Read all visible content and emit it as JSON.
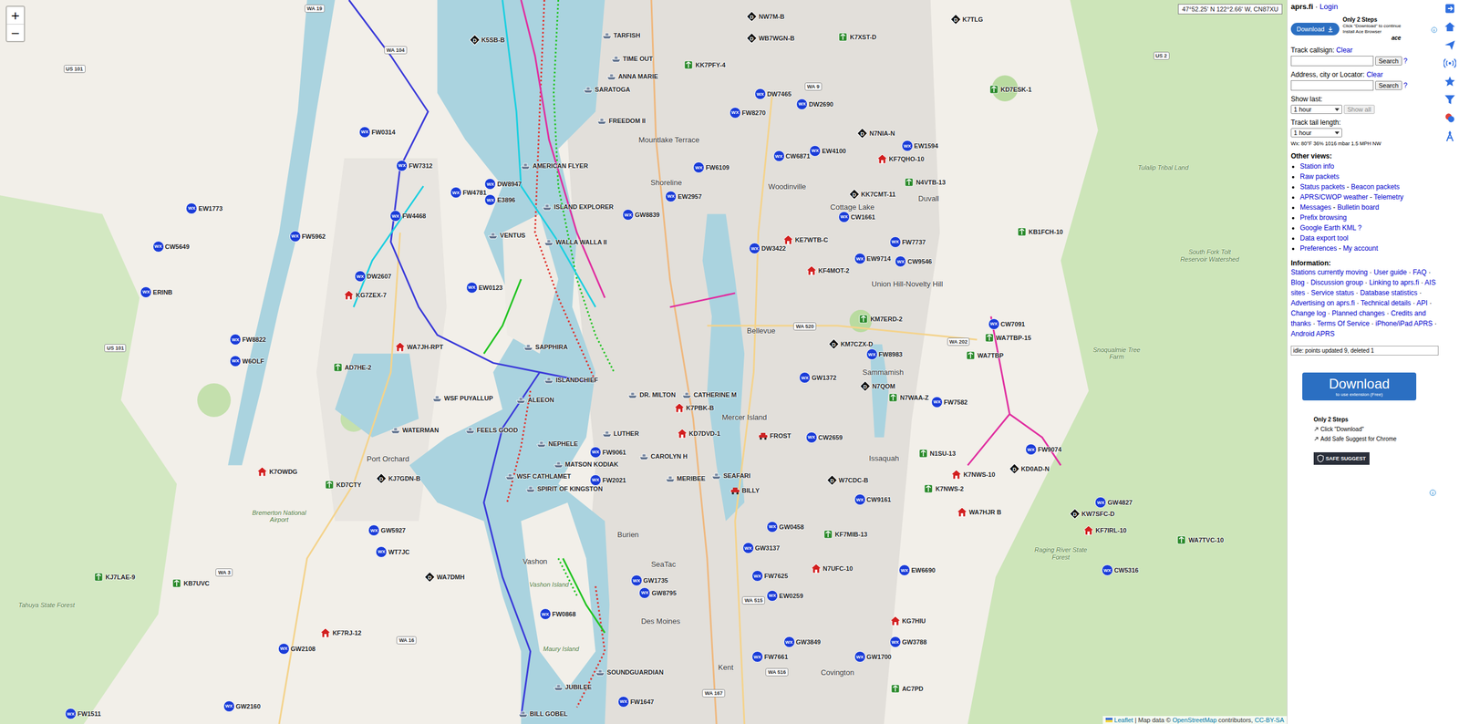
{
  "map": {
    "coords": "47°52.25' N 122°2.66' W, CN87XU",
    "zoom_in": "+",
    "zoom_out": "−",
    "symbols": {
      "wx": "WX",
      "digi": "D"
    },
    "attribution": {
      "leaflet": "Leaflet",
      "sep": " | Map data © ",
      "osm": "OpenStreetMap",
      "mid": " contributors, ",
      "license": "CC-BY-SA"
    },
    "tracks": [
      {
        "color": "#3b3bd9",
        "dashed": false
      },
      {
        "color": "#3b3bd9",
        "dashed": false
      },
      {
        "color": "#23c423",
        "dashed": true
      },
      {
        "color": "#e0302a",
        "dashed": true
      },
      {
        "color": "#1ccfe0",
        "dashed": false
      },
      {
        "color": "#e02fa0",
        "dashed": false
      },
      {
        "color": "#e0302a",
        "dashed": true
      },
      {
        "color": "#23c423",
        "dashed": false
      },
      {
        "color": "#e02fa0",
        "dashed": false
      }
    ],
    "places": [
      {
        "name": "Bellevue",
        "kind": "city"
      },
      {
        "name": "Kent",
        "kind": "city"
      },
      {
        "name": "Burien",
        "kind": "city"
      },
      {
        "name": "SeaTac",
        "kind": "city"
      },
      {
        "name": "Des Moines",
        "kind": "city"
      },
      {
        "name": "Vashon",
        "kind": "city"
      },
      {
        "name": "Vashon Island",
        "kind": "area"
      },
      {
        "name": "Maury Island",
        "kind": "area"
      },
      {
        "name": "Port Orchard",
        "kind": "city"
      },
      {
        "name": "Issaquah",
        "kind": "city"
      },
      {
        "name": "Sammamish",
        "kind": "city"
      },
      {
        "name": "Duvall",
        "kind": "city"
      },
      {
        "name": "Cottage Lake",
        "kind": "city"
      },
      {
        "name": "Woodinville",
        "kind": "city"
      },
      {
        "name": "Shoreline",
        "kind": "city"
      },
      {
        "name": "Mountlake Terrace",
        "kind": "city"
      },
      {
        "name": "Covington",
        "kind": "city"
      },
      {
        "name": "Snoqualmie Tree Farm",
        "kind": "area"
      },
      {
        "name": "Tulalip Tribal Land",
        "kind": "area"
      },
      {
        "name": "South Fork Tolt Reservoir Watershed",
        "kind": "area"
      },
      {
        "name": "Union Hill-Novelty Hill",
        "kind": "city"
      },
      {
        "name": "Bremerton National Airport",
        "kind": "area"
      },
      {
        "name": "Tahuya State Forest",
        "kind": "area"
      },
      {
        "name": "Raging River State Forest",
        "kind": "area"
      },
      {
        "name": "Mercer Island",
        "kind": "city"
      }
    ],
    "shields": [
      "US 101",
      "US 101",
      "WA 3",
      "WA 16",
      "WA 104",
      "WA 19",
      "WA 9",
      "WA 202",
      "WA 520",
      "WA 167",
      "WA 516",
      "WA 515",
      "US 2"
    ],
    "stations": [
      {
        "name": "EW1773",
        "kind": "wx"
      },
      {
        "name": "CW5649",
        "kind": "wx"
      },
      {
        "name": "ERINB",
        "kind": "wx"
      },
      {
        "name": "FW8822",
        "kind": "wx"
      },
      {
        "name": "W6OLF",
        "kind": "wx"
      },
      {
        "name": "FW0314",
        "kind": "wx"
      },
      {
        "name": "FW7312",
        "kind": "wx"
      },
      {
        "name": "FW4781",
        "kind": "wx"
      },
      {
        "name": "FW4468",
        "kind": "wx"
      },
      {
        "name": "FW5962",
        "kind": "wx"
      },
      {
        "name": "DW2607",
        "kind": "wx"
      },
      {
        "name": "DW8947",
        "kind": "wx"
      },
      {
        "name": "E3896",
        "kind": "wx"
      },
      {
        "name": "EW0123",
        "kind": "wx"
      },
      {
        "name": "EW4100",
        "kind": "wx"
      },
      {
        "name": "DW2690",
        "kind": "wx"
      },
      {
        "name": "DW7465",
        "kind": "wx"
      },
      {
        "name": "FW8270",
        "kind": "wx"
      },
      {
        "name": "CW6871",
        "kind": "wx"
      },
      {
        "name": "DW3422",
        "kind": "wx"
      },
      {
        "name": "CW1661",
        "kind": "wx"
      },
      {
        "name": "EW9714",
        "kind": "wx"
      },
      {
        "name": "CW9546",
        "kind": "wx"
      },
      {
        "name": "FW7737",
        "kind": "wx"
      },
      {
        "name": "FW7582",
        "kind": "wx"
      },
      {
        "name": "GW1372",
        "kind": "wx"
      },
      {
        "name": "CW2659",
        "kind": "wx"
      },
      {
        "name": "CW9161",
        "kind": "wx"
      },
      {
        "name": "GW0458",
        "kind": "wx"
      },
      {
        "name": "GW3137",
        "kind": "wx"
      },
      {
        "name": "FW7625",
        "kind": "wx"
      },
      {
        "name": "EW0259",
        "kind": "wx"
      },
      {
        "name": "GW3849",
        "kind": "wx"
      },
      {
        "name": "FW7661",
        "kind": "wx"
      },
      {
        "name": "GW1700",
        "kind": "wx"
      },
      {
        "name": "GW3788",
        "kind": "wx"
      },
      {
        "name": "EW6690",
        "kind": "wx"
      },
      {
        "name": "CW5316",
        "kind": "wx"
      },
      {
        "name": "GW4827",
        "kind": "wx"
      },
      {
        "name": "FW9074",
        "kind": "wx"
      },
      {
        "name": "FW0868",
        "kind": "wx"
      },
      {
        "name": "GW2108",
        "kind": "wx"
      },
      {
        "name": "GW2160",
        "kind": "wx"
      },
      {
        "name": "FW1511",
        "kind": "wx"
      },
      {
        "name": "FW1647",
        "kind": "wx"
      },
      {
        "name": "GW1735",
        "kind": "wx"
      },
      {
        "name": "GW8795",
        "kind": "wx"
      },
      {
        "name": "FW2021",
        "kind": "wx"
      },
      {
        "name": "FW9061",
        "kind": "wx"
      },
      {
        "name": "GW5927",
        "kind": "wx"
      },
      {
        "name": "WT7JC",
        "kind": "wx"
      },
      {
        "name": "FW8983",
        "kind": "wx"
      },
      {
        "name": "GW8839",
        "kind": "wx"
      },
      {
        "name": "EW2957",
        "kind": "wx"
      },
      {
        "name": "FW6109",
        "kind": "wx"
      },
      {
        "name": "EW1594",
        "kind": "wx"
      },
      {
        "name": "CW7091",
        "kind": "wx"
      },
      {
        "name": "K5SB-B",
        "kind": "digi"
      },
      {
        "name": "NW7M-B",
        "kind": "digi"
      },
      {
        "name": "WB7WGN-B",
        "kind": "digi"
      },
      {
        "name": "K7TLG",
        "kind": "digi"
      },
      {
        "name": "K7XST-D",
        "kind": "node"
      },
      {
        "name": "KD7ESK-1",
        "kind": "node"
      },
      {
        "name": "N7NIA-N",
        "kind": "digi"
      },
      {
        "name": "KF7QHO-10",
        "kind": "home"
      },
      {
        "name": "N4VTB-13",
        "kind": "node"
      },
      {
        "name": "KK7CMT-11",
        "kind": "digi"
      },
      {
        "name": "KE7WTB-C",
        "kind": "home"
      },
      {
        "name": "KF4MOT-2",
        "kind": "home"
      },
      {
        "name": "KM7ERD-2",
        "kind": "node"
      },
      {
        "name": "KM7CZX-D",
        "kind": "digi"
      },
      {
        "name": "N7QOM",
        "kind": "digi"
      },
      {
        "name": "N7WAA-Z",
        "kind": "node"
      },
      {
        "name": "W7CDC-B",
        "kind": "digi"
      },
      {
        "name": "N1SU-13",
        "kind": "node"
      },
      {
        "name": "K7NWS-10",
        "kind": "home"
      },
      {
        "name": "K7NWS-2",
        "kind": "node"
      },
      {
        "name": "WA7HJR B",
        "kind": "home"
      },
      {
        "name": "KD0AD-N",
        "kind": "digi"
      },
      {
        "name": "KW7SFC-D",
        "kind": "digi"
      },
      {
        "name": "KF7IRL-10",
        "kind": "home"
      },
      {
        "name": "WA7TVC-10",
        "kind": "node"
      },
      {
        "name": "KF7MIB-13",
        "kind": "node"
      },
      {
        "name": "N7UFC-10",
        "kind": "home"
      },
      {
        "name": "KG7HIU",
        "kind": "home"
      },
      {
        "name": "AC7PD",
        "kind": "node"
      },
      {
        "name": "KD7CTY",
        "kind": "node"
      },
      {
        "name": "KJ7GDN-B",
        "kind": "digi"
      },
      {
        "name": "K7OWDG",
        "kind": "home"
      },
      {
        "name": "KJ7LAE-9",
        "kind": "node"
      },
      {
        "name": "KB7UVC",
        "kind": "node"
      },
      {
        "name": "KF7RJ-12",
        "kind": "home"
      },
      {
        "name": "WA7DMH",
        "kind": "digi"
      },
      {
        "name": "AD7HE-2",
        "kind": "node"
      },
      {
        "name": "KG7ZEX-7",
        "kind": "home"
      },
      {
        "name": "KK7PFY-4",
        "kind": "node"
      },
      {
        "name": "KB1FCH-10",
        "kind": "node"
      },
      {
        "name": "WA7TBP-15",
        "kind": "node"
      },
      {
        "name": "WA7TBP",
        "kind": "node"
      },
      {
        "name": "K7PBK-B",
        "kind": "home"
      },
      {
        "name": "KD7DVD-1",
        "kind": "home"
      },
      {
        "name": "WA7JH-RPT",
        "kind": "home"
      },
      {
        "name": "TARFISH",
        "kind": "ship"
      },
      {
        "name": "TIME OUT",
        "kind": "ship"
      },
      {
        "name": "ANNA MARIE",
        "kind": "ship"
      },
      {
        "name": "SARATOGA",
        "kind": "ship"
      },
      {
        "name": "FREEDOM II",
        "kind": "ship"
      },
      {
        "name": "AMERICAN FLYER",
        "kind": "ship"
      },
      {
        "name": "ISLAND EXPLORER",
        "kind": "ship"
      },
      {
        "name": "WALLA WALLA II",
        "kind": "ship"
      },
      {
        "name": "VENTUS",
        "kind": "ship"
      },
      {
        "name": "SAPPHIRA",
        "kind": "ship"
      },
      {
        "name": "WSF PUYALLUP",
        "kind": "ship"
      },
      {
        "name": "ALEEON",
        "kind": "ship"
      },
      {
        "name": "ISLANDCHIEF",
        "kind": "ship"
      },
      {
        "name": "NEPHELE",
        "kind": "ship"
      },
      {
        "name": "MATSON KODIAK",
        "kind": "ship"
      },
      {
        "name": "WSF CATHLAMET",
        "kind": "ship"
      },
      {
        "name": "SPIRIT OF KINGSTON",
        "kind": "ship"
      },
      {
        "name": "FEELS GOOD",
        "kind": "ship"
      },
      {
        "name": "WATERMAN",
        "kind": "ship"
      },
      {
        "name": "LUTHER",
        "kind": "ship"
      },
      {
        "name": "CAROLYN H",
        "kind": "ship"
      },
      {
        "name": "MERIBEE",
        "kind": "ship"
      },
      {
        "name": "SEAFARI",
        "kind": "ship"
      },
      {
        "name": "DR. MILTON",
        "kind": "ship"
      },
      {
        "name": "CATHERINE M",
        "kind": "ship"
      },
      {
        "name": "FROST",
        "kind": "car"
      },
      {
        "name": "BILLY",
        "kind": "car"
      },
      {
        "name": "SOUNDGUARDIAN",
        "kind": "ship"
      },
      {
        "name": "JUBILEE",
        "kind": "ship"
      },
      {
        "name": "BILL GOBEL",
        "kind": "ship"
      }
    ]
  },
  "sidebar": {
    "header": {
      "site": "aprs.fi",
      "sep": " · ",
      "login": "Login"
    },
    "ad_small": {
      "button": "Download",
      "title": "Only 2 Steps",
      "steps": [
        "Click \"Download\" to continue",
        "Install Ace Browser"
      ],
      "brand": "ace"
    },
    "track": {
      "label": "Track callsign:",
      "clear": "Clear",
      "value": "",
      "search": "Search",
      "help": "?"
    },
    "address": {
      "label": "Address, city or Locator:",
      "clear": "Clear",
      "value": "",
      "search": "Search",
      "help": "?"
    },
    "show_last": {
      "label": "Show last:",
      "value": "1 hour",
      "show_all": "Show all",
      "show_all_disabled": true
    },
    "tail": {
      "label": "Track tail length:",
      "value": "1 hour"
    },
    "wx": "Wx: 80°F 36% 1016 mbar 1.5 MPH NW",
    "other_views": {
      "title": "Other views:",
      "sep": " - ",
      "lines": [
        [
          "Station info"
        ],
        [
          "Raw packets"
        ],
        [
          "Status packets",
          "Beacon packets"
        ],
        [
          "APRS/CWOP weather",
          "Telemetry"
        ],
        [
          "Messages",
          "Bulletin board"
        ],
        [
          "Prefix browsing"
        ],
        [
          "Google Earth KML ?"
        ],
        [
          "Data export tool"
        ],
        [
          "Preferences",
          "My account"
        ]
      ]
    },
    "information": {
      "title": "Information:",
      "sep": " · ",
      "links": [
        "Stations currently moving",
        "User guide",
        "FAQ",
        "Blog",
        "Discussion group",
        "Linking to aprs.fi",
        "AIS sites",
        "Service status",
        "Database statistics",
        "Advertising on aprs.fi",
        "Technical details",
        "API",
        "Change log",
        "Planned changes",
        "Credits and thanks",
        "Terms Of Service",
        "iPhone/iPad APRS",
        "Android APRS"
      ]
    },
    "status": "idle: points updated 9, deleted 1",
    "ad_large": {
      "button": "Download",
      "sub": "to use extension (Free)",
      "title": "Only 2 Steps",
      "steps": [
        "Click \"Download\"",
        "Add Safe Suggest for Chrome"
      ],
      "brand": "SAFE SUGGEST"
    }
  }
}
